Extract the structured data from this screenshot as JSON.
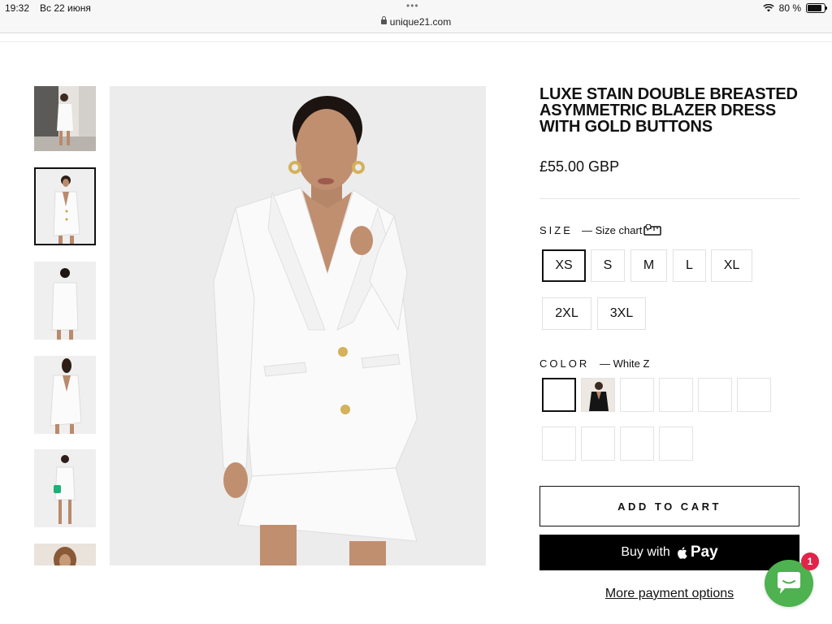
{
  "status_bar": {
    "time": "19:32",
    "date": "Вс 22 июня",
    "url": "unique21.com",
    "battery": "80 %",
    "battery_level": 0.8
  },
  "gallery": {
    "thumbnail_count": 6,
    "active_index": 1
  },
  "product": {
    "title": "LUXE STAIN DOUBLE BREASTED ASYMMETRIC BLAZER DRESS WITH GOLD BUTTONS",
    "price": "£55.00 GBP"
  },
  "size": {
    "label": "SIZE",
    "chart_link": "— Size chart",
    "options": [
      "XS",
      "S",
      "M",
      "L",
      "XL",
      "2XL",
      "3XL"
    ],
    "selected": "XS"
  },
  "color": {
    "label": "COLOR",
    "selected_name": "— White Z",
    "swatch_count": 10,
    "selected_index": 0
  },
  "actions": {
    "add_to_cart": "ADD TO CART",
    "buy_with": "Buy with",
    "pay": "Pay",
    "more_payment": "More payment options"
  },
  "chat": {
    "badge_count": "1"
  },
  "colors": {
    "accent": "#111111",
    "chat_green": "#4db24f",
    "badge_red": "#e0244a"
  }
}
